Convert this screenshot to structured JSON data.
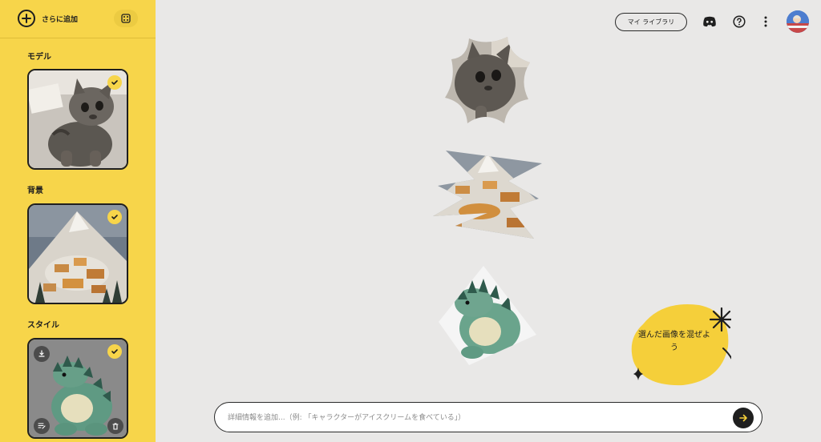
{
  "sidebar": {
    "add_more_label": "さらに追加",
    "sections": [
      {
        "label": "モデル",
        "image": "kitten photo",
        "selected": true
      },
      {
        "label": "背景",
        "image": "mountain village",
        "selected": true
      },
      {
        "label": "スタイル",
        "image": "green dinosaur plush",
        "selected": true
      }
    ]
  },
  "topbar": {
    "library_label": "マイ ライブラリ",
    "icons": [
      "discord-icon",
      "help-icon",
      "more-vert-icon",
      "avatar"
    ]
  },
  "canvas": {
    "pieces": [
      "kitten-shape",
      "village-shape",
      "dinosaur-shape"
    ]
  },
  "hint": {
    "text": "選んだ画像を混ぜよう"
  },
  "prompt": {
    "placeholder": "詳細情報を追加...（例: 「キャラクターがアイスクリームを食べている」）",
    "value": ""
  },
  "colors": {
    "sidebar": "#f7d54a",
    "background": "#e9e8e7",
    "accent": "#f5cf3a",
    "dark": "#1f1f1f"
  }
}
